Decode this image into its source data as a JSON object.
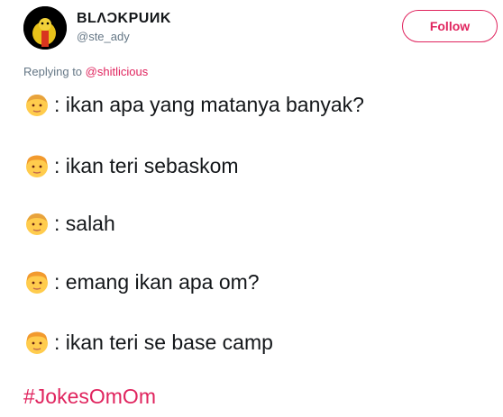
{
  "header": {
    "display_name": "BLΛϽKPUИK",
    "handle": "@ste_ady",
    "follow_label": "Follow"
  },
  "reply": {
    "prefix": "Replying to",
    "mention": "@shitlicious"
  },
  "tweet": {
    "lines": [
      {
        "emoji": "older-man-emoji",
        "text": ": ikan apa yang matanya banyak?"
      },
      {
        "emoji": "man-emoji",
        "text": ": ikan teri sebaskom"
      },
      {
        "emoji": "older-man-emoji",
        "text": ": salah"
      },
      {
        "emoji": "man-emoji",
        "text": ": emang ikan apa om?"
      },
      {
        "emoji": "man-emoji",
        "text": ": ikan teri se base camp"
      }
    ],
    "hashtag": "#JokesOmOm"
  },
  "colors": {
    "accent": "#e0245e",
    "secondary_text": "#657786",
    "primary_text": "#14171a"
  }
}
